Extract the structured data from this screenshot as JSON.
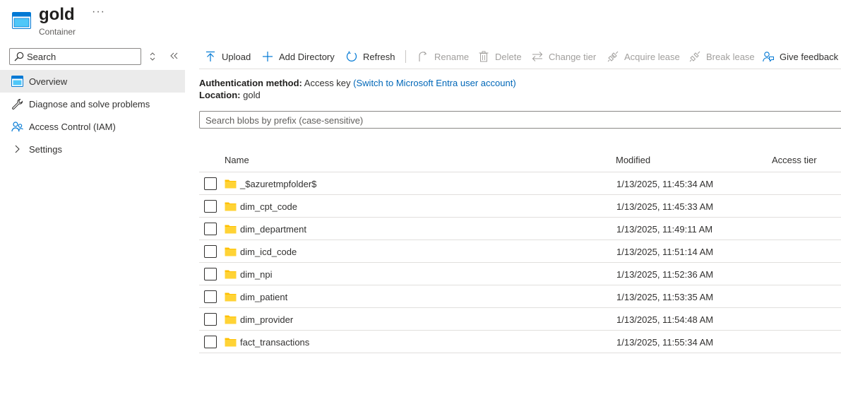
{
  "header": {
    "title": "gold",
    "more": "···",
    "subtitle": "Container"
  },
  "sidebar": {
    "search_placeholder": "Search",
    "items": [
      {
        "label": "Overview",
        "icon": "container-icon",
        "active": true
      },
      {
        "label": "Diagnose and solve problems",
        "icon": "wrench-icon",
        "active": false
      },
      {
        "label": "Access Control (IAM)",
        "icon": "people-icon",
        "active": false
      },
      {
        "label": "Settings",
        "icon": "chevron-right-icon",
        "active": false
      }
    ]
  },
  "toolbar": {
    "upload": "Upload",
    "add_directory": "Add Directory",
    "refresh": "Refresh",
    "rename": "Rename",
    "delete": "Delete",
    "change_tier": "Change tier",
    "acquire_lease": "Acquire lease",
    "break_lease": "Break lease",
    "give_feedback": "Give feedback"
  },
  "info": {
    "auth_label": "Authentication method:",
    "auth_value": "Access key",
    "auth_link": "(Switch to Microsoft Entra user account)",
    "location_label": "Location:",
    "location_value": "gold"
  },
  "blob_search": {
    "placeholder": "Search blobs by prefix (case-sensitive)"
  },
  "table": {
    "columns": [
      "Name",
      "Modified",
      "Access tier"
    ],
    "rows": [
      {
        "name": "_$azuretmpfolder$",
        "modified": "1/13/2025, 11:45:34 AM"
      },
      {
        "name": "dim_cpt_code",
        "modified": "1/13/2025, 11:45:33 AM"
      },
      {
        "name": "dim_department",
        "modified": "1/13/2025, 11:49:11 AM"
      },
      {
        "name": "dim_icd_code",
        "modified": "1/13/2025, 11:51:14 AM"
      },
      {
        "name": "dim_npi",
        "modified": "1/13/2025, 11:52:36 AM"
      },
      {
        "name": "dim_patient",
        "modified": "1/13/2025, 11:53:35 AM"
      },
      {
        "name": "dim_provider",
        "modified": "1/13/2025, 11:54:48 AM"
      },
      {
        "name": "fact_transactions",
        "modified": "1/13/2025, 11:55:34 AM"
      }
    ]
  },
  "colors": {
    "accent": "#0078d4",
    "link": "#0067b8",
    "folder": "#ffc000",
    "active_bg": "#ebebeb",
    "disabled_text": "#a19f9d"
  }
}
